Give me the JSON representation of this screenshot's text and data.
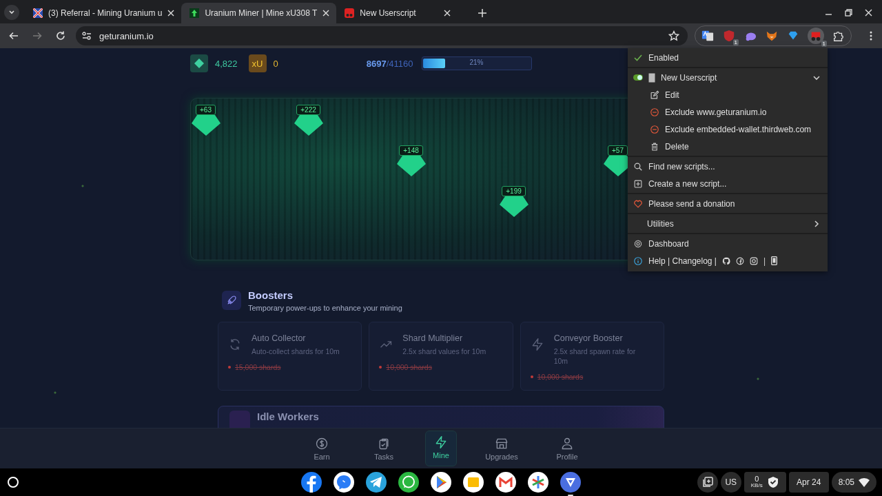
{
  "browser": {
    "tabs": [
      {
        "title": "(3) Referral - Mining Uranium u",
        "kind": "flag",
        "selected": false
      },
      {
        "title": "Uranium Miner | Mine xU308 T",
        "kind": "arrow",
        "selected": true
      },
      {
        "title": "New Userscript",
        "kind": "monkey",
        "selected": false
      }
    ],
    "address": "geturanium.io",
    "extensions": [
      {
        "kind": "translate"
      },
      {
        "kind": "shield",
        "badge": "1"
      },
      {
        "kind": "cloud"
      },
      {
        "kind": "fox"
      },
      {
        "kind": "diamond"
      },
      {
        "kind": "monkey",
        "badge": "1",
        "selected": true
      },
      {
        "kind": "puzzle"
      }
    ]
  },
  "stats": {
    "shards": "4,822",
    "token_icon": "xU",
    "tokens": "0",
    "progress_current": "8697",
    "progress_total": "/41160",
    "level": 0.21,
    "progress_label": "21%"
  },
  "mine": {
    "shards": [
      {
        "value": "+63"
      },
      {
        "value": "+222"
      },
      {
        "value": "+148"
      },
      {
        "value": "+199"
      },
      {
        "value": "+57"
      }
    ]
  },
  "boosters": {
    "title": "Boosters",
    "subtitle": "Temporary power-ups to enhance your mining",
    "cards": [
      {
        "kind": "refresh",
        "title": "Auto Collector",
        "description": "Auto-collect shards for 10m",
        "price": "15,000 shards",
        "affordable": false
      },
      {
        "kind": "trend",
        "title": "Shard Multiplier",
        "description": "2.5x shard values for 10m",
        "price": "10,000 shards",
        "affordable": false
      },
      {
        "kind": "bolt",
        "title": "Conveyor Booster",
        "description": "2.5x shard spawn rate for 10m",
        "price": "10,000 shards",
        "affordable": false
      }
    ]
  },
  "idle_workers": {
    "title": "Idle Workers"
  },
  "nav": [
    {
      "kind": "dollar",
      "label": "Earn",
      "selected": false
    },
    {
      "kind": "clipboard",
      "label": "Tasks",
      "selected": false
    },
    {
      "kind": "bolt",
      "label": "Mine",
      "selected": true
    },
    {
      "kind": "store",
      "label": "Upgrades",
      "selected": false
    },
    {
      "kind": "person",
      "label": "Profile",
      "selected": false
    }
  ],
  "menu": {
    "sections": [
      [
        {
          "kind": "status",
          "label": "Enabled",
          "checked": true
        }
      ],
      [
        {
          "kind": "script",
          "label": "New Userscript",
          "on": true,
          "expanded": true
        },
        {
          "kind": "edit",
          "label": "Edit"
        },
        {
          "kind": "exclude",
          "label": "Exclude www.geturanium.io"
        },
        {
          "kind": "exclude",
          "label": "Exclude embedded-wallet.thirdweb.com"
        },
        {
          "kind": "trash",
          "label": "Delete"
        }
      ],
      [
        {
          "kind": "search",
          "label": "Find new scripts..."
        },
        {
          "kind": "plus",
          "label": "Create a new script..."
        }
      ],
      [
        {
          "kind": "heart",
          "label": "Please send a donation"
        }
      ],
      [
        {
          "kind": "submenu",
          "label": "Utilities"
        }
      ],
      [
        {
          "kind": "gear",
          "label": "Dashboard"
        },
        {
          "kind": "help",
          "label": "Help | Changelog |",
          "separator": "|"
        }
      ]
    ]
  },
  "shelf": {
    "apps": [
      {
        "kind": "facebook"
      },
      {
        "kind": "messenger"
      },
      {
        "kind": "telegram"
      },
      {
        "kind": "whatsapp"
      },
      {
        "kind": "play"
      },
      {
        "kind": "files"
      },
      {
        "kind": "gmail"
      },
      {
        "kind": "photos"
      },
      {
        "kind": "vpn",
        "selected": true
      }
    ],
    "keyboard": "US",
    "net_speed": "0",
    "net_unit": "KB/s",
    "date": "Apr 24",
    "time": "8:05"
  }
}
